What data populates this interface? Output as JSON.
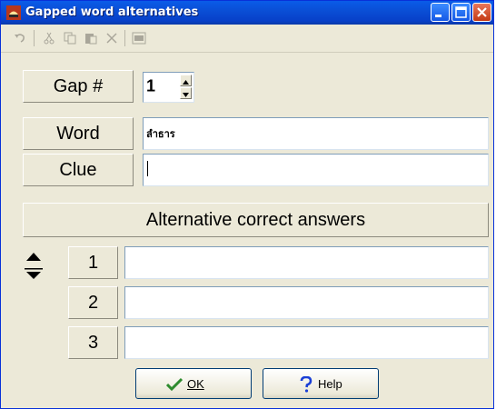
{
  "window": {
    "title": "Gapped word alternatives"
  },
  "toolbar": {
    "icons": [
      "undo-icon",
      "cut-icon",
      "copy-icon",
      "paste-icon",
      "delete-icon",
      "select-all-icon"
    ]
  },
  "form": {
    "gap_label": "Gap #",
    "gap_value": "1",
    "word_label": "Word",
    "word_value": "ลำธาร",
    "clue_label": "Clue",
    "clue_value": ""
  },
  "alternatives": {
    "header": "Alternative correct answers",
    "rows": [
      {
        "num": "1",
        "value": ""
      },
      {
        "num": "2",
        "value": ""
      },
      {
        "num": "3",
        "value": ""
      }
    ]
  },
  "buttons": {
    "ok_label": "OK",
    "help_label": "Help"
  }
}
